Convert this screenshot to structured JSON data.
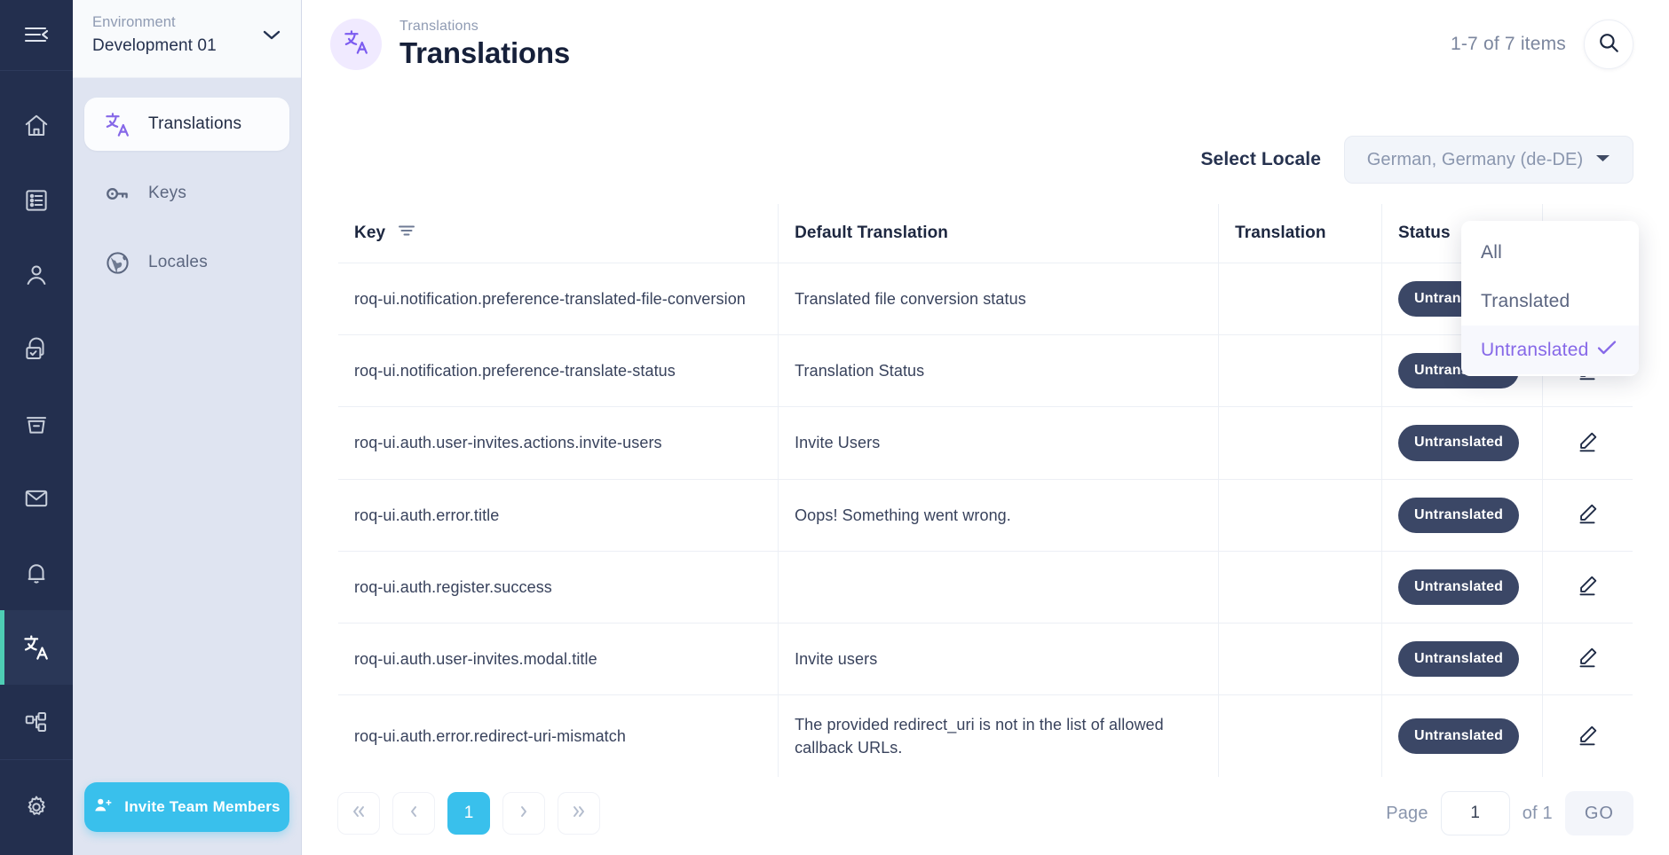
{
  "rail": {
    "collapse_icon": "menu-collapse-icon",
    "items": [
      {
        "icon": "home-icon",
        "name": "home"
      },
      {
        "icon": "list-icon",
        "name": "list"
      },
      {
        "icon": "user-icon",
        "name": "users"
      },
      {
        "icon": "lock-check-icon",
        "name": "security"
      },
      {
        "icon": "archive-icon",
        "name": "archive"
      },
      {
        "icon": "mail-icon",
        "name": "mail"
      },
      {
        "icon": "bell-icon",
        "name": "notifications"
      },
      {
        "icon": "translate-icon",
        "name": "translations",
        "active": true
      },
      {
        "icon": "sitemap-icon",
        "name": "structure"
      }
    ],
    "settings_icon": "gear-icon"
  },
  "sidebar": {
    "env_label": "Environment",
    "env_value": "Development 01",
    "chevron_icon": "chevron-down-icon",
    "items": [
      {
        "label": "Translations",
        "icon": "translate-icon",
        "active": true
      },
      {
        "label": "Keys",
        "icon": "key-icon",
        "active": false
      },
      {
        "label": "Locales",
        "icon": "globe-icon",
        "active": false
      }
    ],
    "invite_label": "Invite Team Members",
    "invite_icon": "user-plus-icon"
  },
  "header": {
    "breadcrumb": "Translations",
    "title": "Translations",
    "icon": "translate-icon",
    "items_count": "1-7 of 7 items",
    "search_icon": "search-icon"
  },
  "locale": {
    "label": "Select Locale",
    "selected": "German, Germany (de-DE)",
    "chevron_icon": "caret-down-icon"
  },
  "table": {
    "columns": [
      "Key",
      "Default Translation",
      "Translation",
      "Status",
      ""
    ],
    "filter_icon": "filter-icon",
    "edit_icon": "pencil-icon",
    "rows": [
      {
        "key": "roq-ui.notification.preference-translated-file-conversion",
        "default": "Translated file conversion status",
        "translation": "",
        "status": "Untranslated"
      },
      {
        "key": "roq-ui.notification.preference-translate-status",
        "default": "Translation Status",
        "translation": "",
        "status": "Untranslated"
      },
      {
        "key": "roq-ui.auth.user-invites.actions.invite-users",
        "default": "Invite Users",
        "translation": "",
        "status": "Untranslated"
      },
      {
        "key": "roq-ui.auth.error.title",
        "default": "Oops! Something went wrong.",
        "translation": "",
        "status": "Untranslated"
      },
      {
        "key": "roq-ui.auth.register.success",
        "default": "",
        "translation": "",
        "status": "Untranslated"
      },
      {
        "key": "roq-ui.auth.user-invites.modal.title",
        "default": "Invite users",
        "translation": "",
        "status": "Untranslated"
      },
      {
        "key": "roq-ui.auth.error.redirect-uri-mismatch",
        "default": "The provided redirect_uri is not in the list of allowed callback URLs.",
        "translation": "",
        "status": "Untranslated"
      }
    ]
  },
  "status_dropdown": {
    "open": true,
    "options": [
      {
        "label": "All",
        "selected": false
      },
      {
        "label": "Translated",
        "selected": false
      },
      {
        "label": "Untranslated",
        "selected": true
      }
    ],
    "check_icon": "check-icon"
  },
  "pagination": {
    "first_icon": "double-chevron-left-icon",
    "prev_icon": "chevron-left-icon",
    "current_page": "1",
    "next_icon": "chevron-right-icon",
    "last_icon": "double-chevron-right-icon",
    "page_label": "Page",
    "page_value": "1",
    "of_label": "of 1",
    "go_label": "GO"
  },
  "colors": {
    "rail_bg": "#232f4e",
    "accent_cyan": "#39c0ec",
    "accent_purple": "#8668e8",
    "badge_dark": "#3b4766",
    "active_marker": "#4ecdb4"
  }
}
